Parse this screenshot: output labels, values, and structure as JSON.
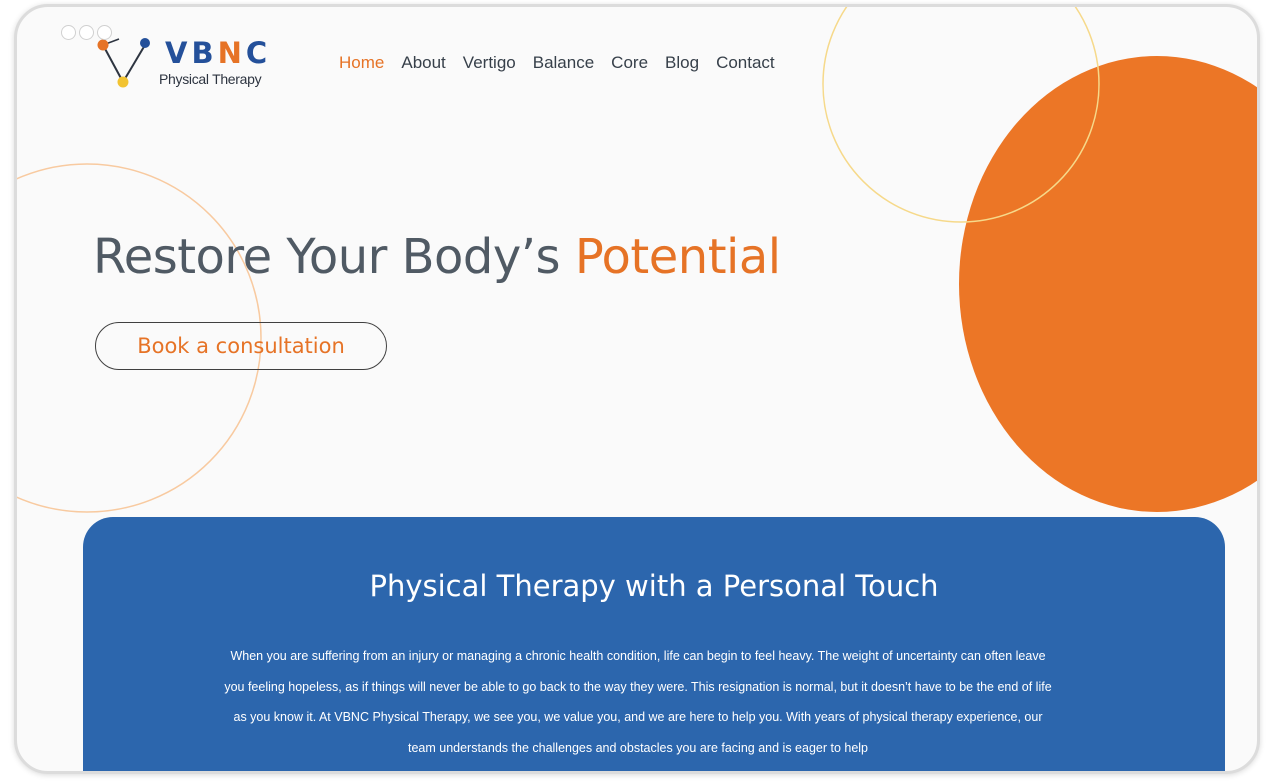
{
  "logo": {
    "brand_main": "VB",
    "brand_accent": "N",
    "brand_end": "C",
    "subtitle": "Physical Therapy"
  },
  "nav": [
    {
      "label": "Home",
      "active": true
    },
    {
      "label": "About"
    },
    {
      "label": "Vertigo"
    },
    {
      "label": "Balance"
    },
    {
      "label": "Core"
    },
    {
      "label": "Blog"
    },
    {
      "label": "Contact"
    }
  ],
  "hero": {
    "title_part1": "Restore Your Body’s ",
    "title_part2": "Potential",
    "cta_label": "Book a consultation"
  },
  "section": {
    "title": "Physical Therapy with a Personal Touch",
    "body": "When you are suffering from an injury or managing a chronic health condition, life can begin to feel heavy. The weight of uncertainty can often leave you feeling hopeless, as if things will never be able to go back to the way they were. This resignation is normal, but it doesn’t have to be the end of life as you know it. At VBNC Physical Therapy, we see you, we value you, and we are here to help you. With years of physical therapy experience, our team understands the challenges and obstacles you are facing and is eager to help"
  },
  "colors": {
    "accent_orange": "#e67326",
    "brand_blue": "#24509a",
    "panel_blue": "#2c66ad",
    "heading_gray": "#505a64",
    "circle_yellow": "#f6d98a",
    "circle_peach": "#f8caa0"
  },
  "icons": {
    "logo_mark": "molecule-logo-icon",
    "window_controls": "window-control-dots"
  }
}
